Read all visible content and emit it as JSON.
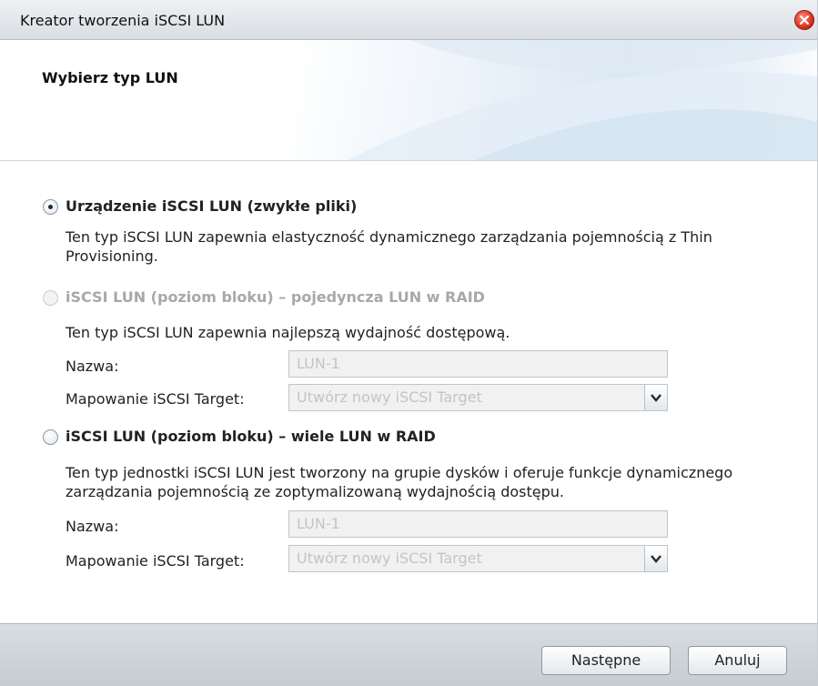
{
  "window": {
    "title": "Kreator tworzenia iSCSI LUN"
  },
  "header": {
    "title": "Wybierz typ LUN"
  },
  "options": [
    {
      "label": "Urządzenie iSCSI LUN (zwykłe pliki)",
      "selected": true,
      "enabled": true,
      "description": "Ten typ iSCSI LUN zapewnia elastyczność dynamicznego zarządzania pojemnością z Thin Provisioning."
    },
    {
      "label": "iSCSI LUN (poziom bloku) – pojedyncza LUN w RAID",
      "selected": false,
      "enabled": false,
      "description": "Ten typ iSCSI LUN zapewnia najlepszą wydajność dostępową.",
      "name_label": "Nazwa:",
      "name_value": "LUN-1",
      "target_label": "Mapowanie iSCSI Target:",
      "target_value": "Utwórz nowy iSCSI Target"
    },
    {
      "label": "iSCSI LUN (poziom bloku) – wiele LUN w RAID",
      "selected": false,
      "enabled": true,
      "description": "Ten typ jednostki iSCSI LUN jest tworzony na grupie dysków i oferuje funkcje dynamicznego zarządzania pojemnością ze zoptymalizowaną wydajnością dostępu.",
      "name_label": "Nazwa:",
      "name_value": "LUN-1",
      "target_label": "Mapowanie iSCSI Target:",
      "target_value": "Utwórz nowy iSCSI Target"
    }
  ],
  "footer": {
    "next_label": "Następne",
    "cancel_label": "Anuluj"
  },
  "icons": {
    "close": "close-icon",
    "dropdown": "chevron-down-icon"
  },
  "colors": {
    "close_button": "#d8321f",
    "disabled_text": "#a8a8a8",
    "footer_bg": "#ccd2d8"
  }
}
